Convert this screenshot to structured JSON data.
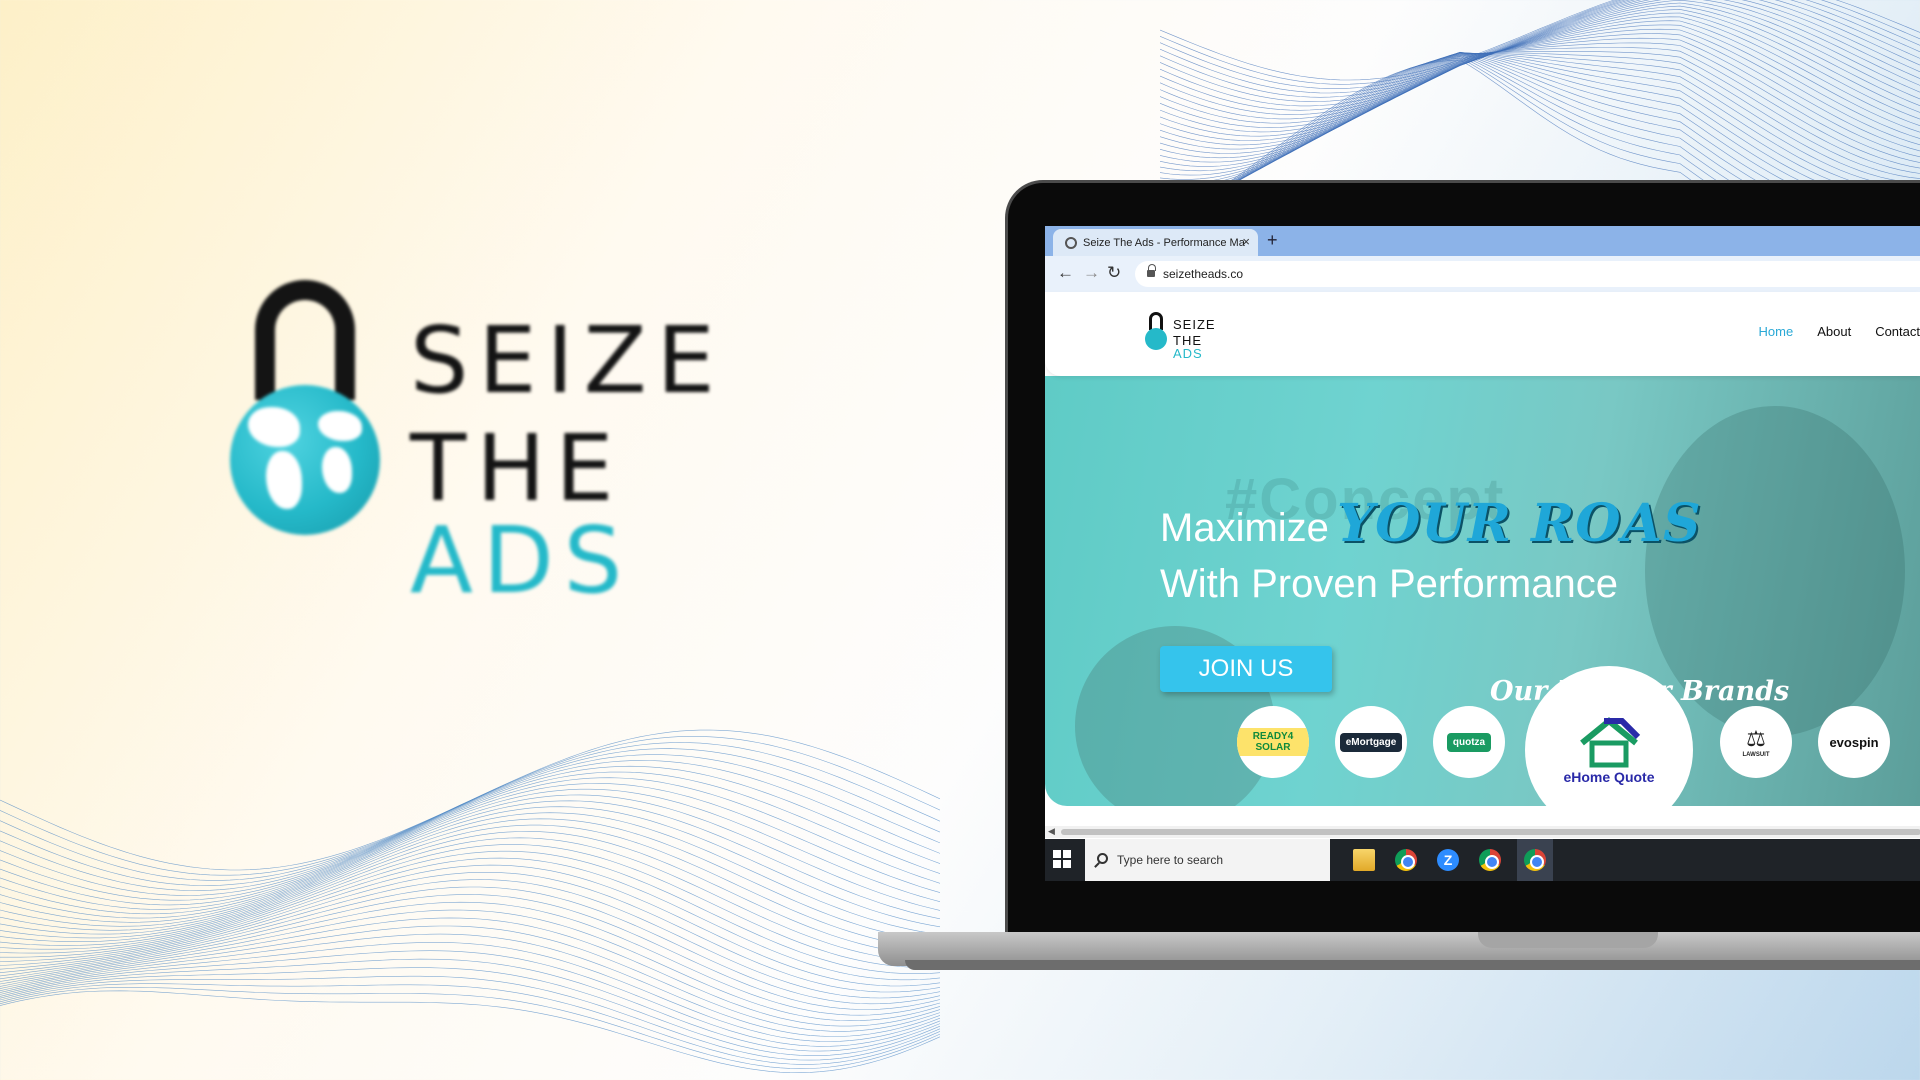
{
  "brand_logo": {
    "line1": "SEIZE",
    "line2_prefix": "THE ",
    "line2_accent": "ADS",
    "accent_color": "#25b9c9"
  },
  "browser": {
    "tab_title": "Seize The Ads - Performance Ma",
    "tab_close": "×",
    "new_tab": "+",
    "url": "seizetheads.co",
    "icons": [
      "back-arrow-icon",
      "forward-arrow-icon",
      "reload-icon",
      "lock-icon"
    ]
  },
  "site": {
    "logo_line1": "SEIZE",
    "logo_line2_prefix": "THE ",
    "logo_line2_accent": "ADS",
    "nav": [
      "Home",
      "About",
      "Contact"
    ],
    "active_nav": "Home",
    "ghost_text": "#Concept",
    "hero_line1_prefix": "Maximize",
    "hero_line1_accent": "YOUR ROAS",
    "hero_line2": "With Proven Performance",
    "cta": "JOIN US",
    "partners_title": "Our Partner Brands",
    "partners": [
      {
        "name": "READY4 SOLAR",
        "color": "#f0c419"
      },
      {
        "name": "eMortgage",
        "color": "#1b2a3a"
      },
      {
        "name": "quotza",
        "color": "#1a9b62"
      },
      {
        "name": "eHome Quote",
        "color": "#2a2aa8"
      },
      {
        "name": "LAWSUIT",
        "color": "#222222"
      },
      {
        "name": "evospin",
        "color": "#111111"
      }
    ]
  },
  "taskbar": {
    "search_placeholder": "Type here to search",
    "apps": [
      "file-explorer-icon",
      "chrome-icon",
      "zoom-icon",
      "chrome-profile-icon",
      "chrome-active-icon"
    ]
  }
}
